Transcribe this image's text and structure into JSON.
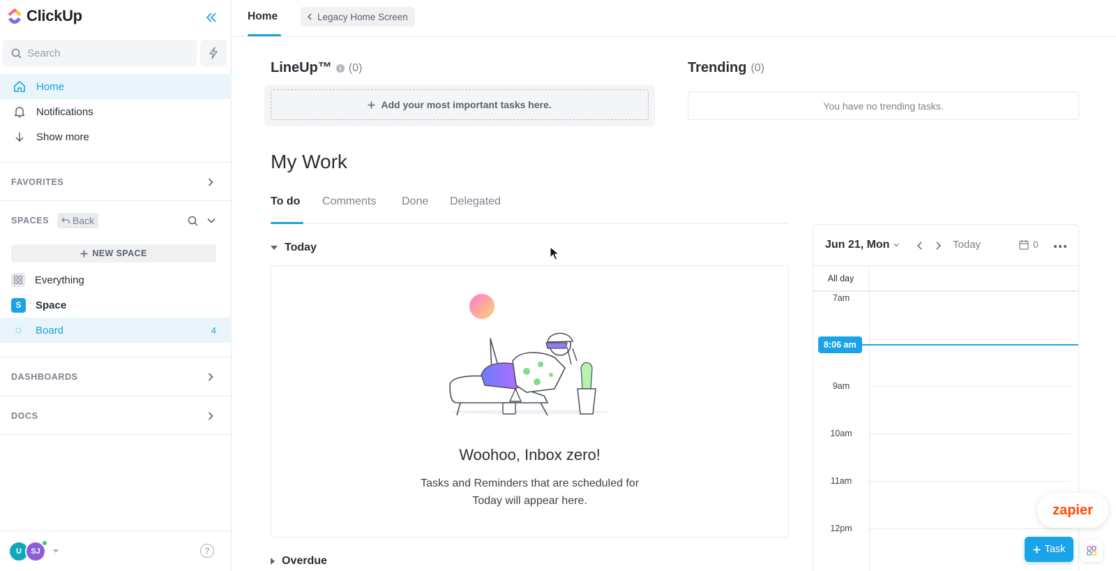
{
  "app": {
    "name": "ClickUp"
  },
  "sidebar": {
    "search_placeholder": "Search",
    "nav": [
      {
        "label": "Home",
        "icon": "home-icon",
        "active": true
      },
      {
        "label": "Notifications",
        "icon": "bell-icon"
      },
      {
        "label": "Show more",
        "icon": "arrow-down-icon"
      }
    ],
    "favorites_label": "FAVORITES",
    "spaces_label": "SPACES",
    "back_label": "Back",
    "new_space_label": "NEW SPACE",
    "everything_label": "Everything",
    "space": {
      "initial": "S",
      "label": "Space"
    },
    "board": {
      "label": "Board",
      "count": "4"
    },
    "dashboards_label": "DASHBOARDS",
    "docs_label": "DOCS",
    "avatars": [
      "U",
      "SJ"
    ],
    "help_label": "?"
  },
  "topbar": {
    "tab": "Home",
    "legacy_label": "Legacy Home Screen"
  },
  "lineup": {
    "title": "LineUp™",
    "count": "(0)",
    "add_label": "Add your most important tasks here."
  },
  "trending": {
    "title": "Trending",
    "count": "(0)",
    "empty": "You have no trending tasks."
  },
  "mywork": {
    "title": "My Work",
    "tabs": [
      "To do",
      "Comments",
      "Done",
      "Delegated"
    ],
    "active_tab": "To do",
    "today_label": "Today",
    "overdue_label": "Overdue",
    "empty_title": "Woohoo, Inbox zero!",
    "empty_line1": "Tasks and Reminders that are scheduled for",
    "empty_line2": "Today will appear here."
  },
  "calendar": {
    "date_label": "Jun 21, Mon",
    "today_label": "Today",
    "count": "0",
    "all_day_label": "All day",
    "now_label": "8:06 am",
    "hours": [
      "7am",
      "9am",
      "10am",
      "11am",
      "12pm"
    ]
  },
  "floating": {
    "zapier_label": "zapier",
    "task_label": "Task"
  },
  "colors": {
    "accent": "#1aa3e8",
    "active_bg": "#e9f4fb",
    "zapier": "#ff4a00"
  }
}
